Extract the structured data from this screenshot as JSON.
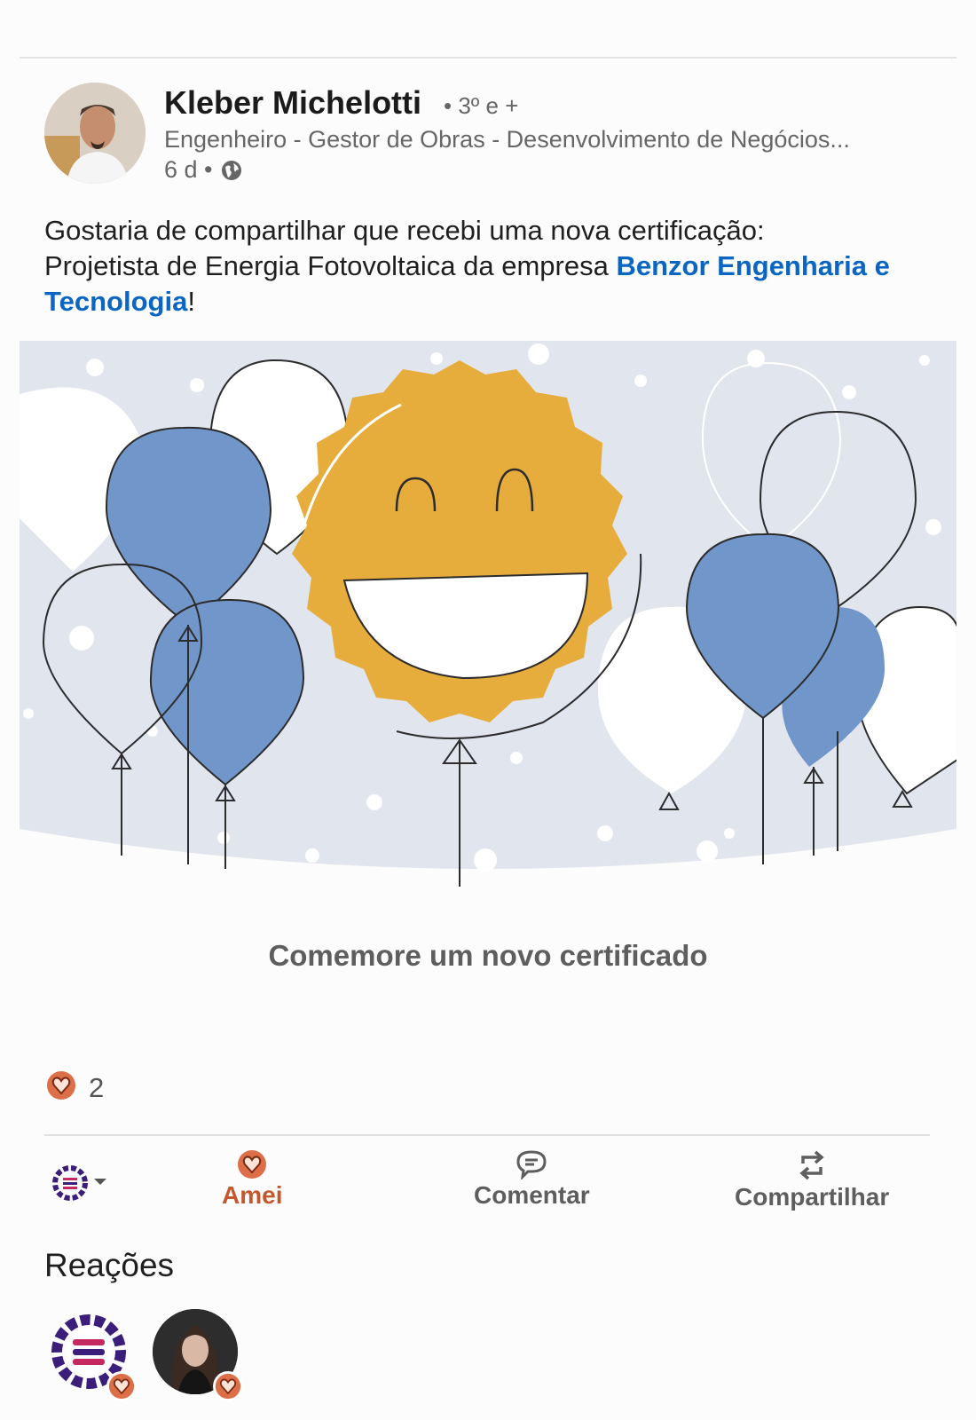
{
  "author": {
    "name": "Kleber Michelotti",
    "degree": "• 3º e +",
    "headline": "Engenheiro - Gestor de Obras - Desenvolvimento de Negócios...",
    "time": "6 d •"
  },
  "post": {
    "text_line1": "Gostaria de compartilhar que recebi uma nova certificação:",
    "text_line2": "Projetista de Energia Fotovoltaica da empresa ",
    "company_link": "Benzor Engenharia e Tecnologia",
    "text_end": "!"
  },
  "card": {
    "caption": "Comemore um novo certificado"
  },
  "reactions": {
    "count": "2"
  },
  "actions": {
    "love_label": "Amei",
    "comment_label": "Comentar",
    "share_label": "Compartilhar"
  },
  "section": {
    "reactions_title": "Reações"
  },
  "colors": {
    "link": "#0a66c2",
    "love": "#c4572c",
    "balloon_blue": "#7196ca",
    "badge_gold": "#e6ad3c"
  }
}
